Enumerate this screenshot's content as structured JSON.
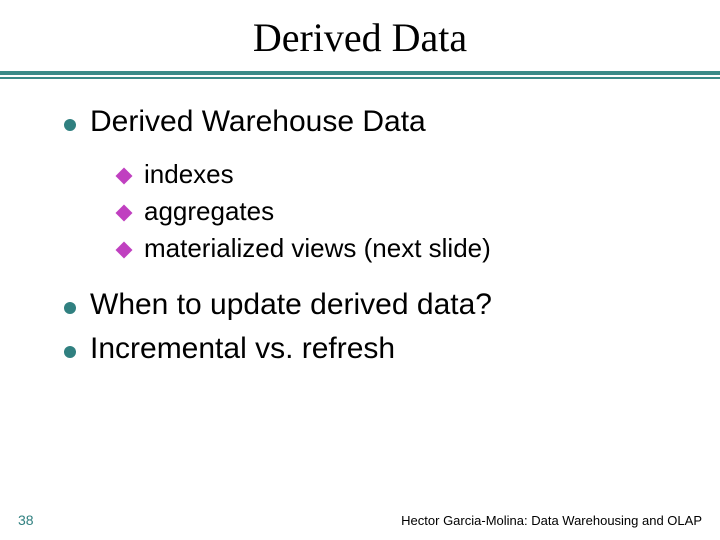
{
  "slide": {
    "title": "Derived Data",
    "bullets": [
      {
        "text": "Derived Warehouse Data",
        "sub": [
          "indexes",
          "aggregates",
          "materialized views (next slide)"
        ]
      },
      {
        "text": "When to update derived data?"
      },
      {
        "text": "Incremental vs. refresh"
      }
    ],
    "page_number": "38",
    "footer": "Hector Garcia-Molina: Data Warehousing and OLAP"
  }
}
